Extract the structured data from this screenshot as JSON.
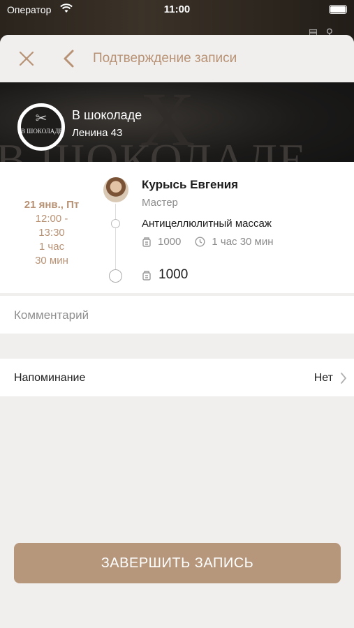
{
  "status_bar": {
    "carrier": "Оператор",
    "time": "11:00"
  },
  "header": {
    "title": "Подтверждение записи"
  },
  "salon": {
    "name": "В шоколаде",
    "address": "Ленина 43",
    "logo_text": "В ШОКОЛАДЕ",
    "watermark": "В ШОКОЛАДЕ"
  },
  "booking": {
    "date": "21 янв., Пт",
    "time_range": [
      "12:00 -",
      "13:30"
    ],
    "duration": [
      "1 час",
      "30 мин"
    ],
    "master_name": "Курысь Евгения",
    "master_role": "Мастер",
    "service": "Антицеллюлитный массаж",
    "service_price": "1000",
    "service_duration": "1 час 30 мин",
    "total": "1000"
  },
  "comment": {
    "placeholder": "Комментарий"
  },
  "reminder": {
    "label": "Напоминание",
    "value": "Нет"
  },
  "actions": {
    "finish_label": "ЗАВЕРШИТЬ ЗАПИСЬ"
  },
  "colors": {
    "accent": "#b89275",
    "button": "#b7977c",
    "sheet_bg": "#f0efee"
  }
}
